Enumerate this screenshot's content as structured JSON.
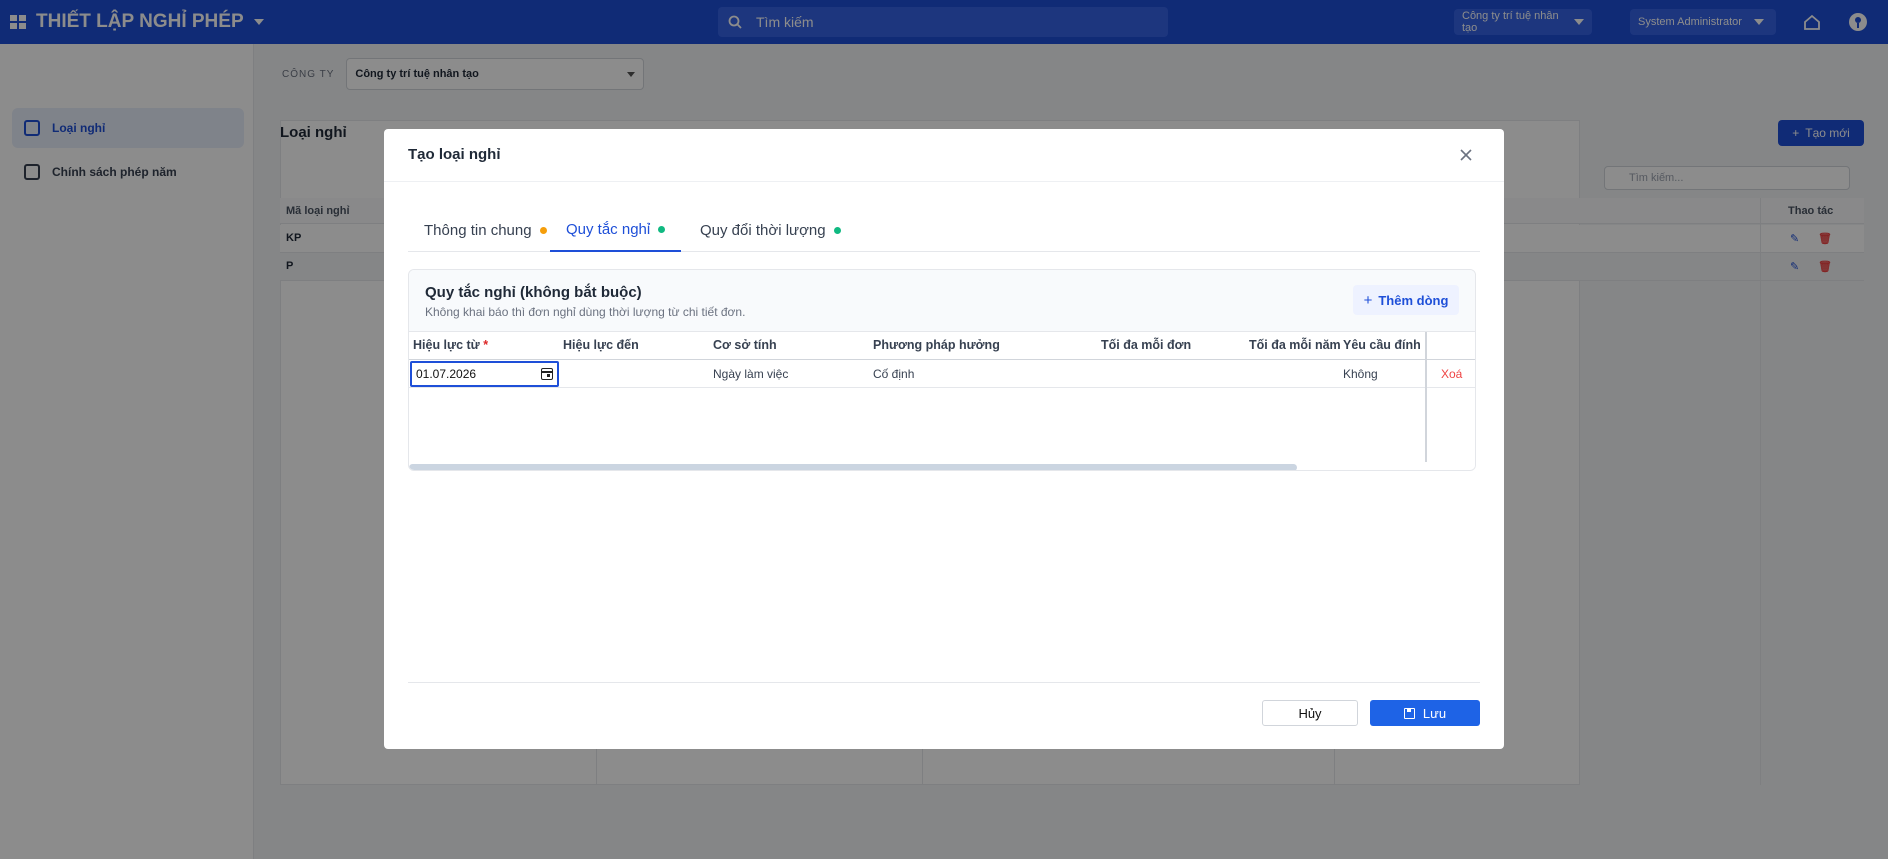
{
  "header": {
    "app_title": "THIẾT LẬP NGHỈ PHÉP",
    "search_placeholder": "Tìm kiếm",
    "company_pill": "Công ty trí tuệ nhân tạo",
    "user_pill": "System Administrator"
  },
  "sidebar": {
    "items": [
      {
        "label": "Loại nghỉ",
        "icon": "box-icon",
        "active": true
      },
      {
        "label": "Chính sách phép năm",
        "icon": "calendar-icon",
        "active": false
      }
    ]
  },
  "page": {
    "company_label": "CÔNG TY",
    "company_value": "Công ty trí tuệ nhân tạo",
    "title": "Loại nghỉ",
    "new_button": "Tạo mới",
    "search_placeholder": "Tìm kiếm...",
    "columns": [
      "Mã loại nghỉ",
      "Thao tác"
    ],
    "rows": [
      {
        "code": "KP"
      },
      {
        "code": "P"
      }
    ]
  },
  "modal": {
    "title": "Tạo loại nghỉ",
    "tabs": [
      {
        "label": "Thông tin chung",
        "dot_color": "#f59e0b",
        "active": false
      },
      {
        "label": "Quy tắc nghỉ",
        "dot_color": "#10b981",
        "active": true
      },
      {
        "label": "Quy đổi thời lượng",
        "dot_color": "#10b981",
        "active": false
      }
    ],
    "rules": {
      "title": "Quy tắc nghỉ (không bắt buộc)",
      "subtitle": "Không khai báo thì đơn nghỉ dùng thời lượng từ chi tiết đơn.",
      "add_button": "Thêm dòng",
      "columns": {
        "effective_from": "Hiệu lực từ",
        "required_mark": "*",
        "effective_to": "Hiệu lực đến",
        "basis": "Cơ sở tính",
        "method": "Phương pháp hưởng",
        "max_per_request": "Tối đa mỗi đơn",
        "max_per_year": "Tối đa mỗi năm",
        "attachment": "Yêu cầu đính k"
      },
      "rows": [
        {
          "effective_from": "01.07.2026",
          "effective_to": "",
          "basis": "Ngày làm việc",
          "method": "Cố định",
          "max_per_request": "",
          "max_per_year": "",
          "attachment": "Không",
          "delete": "Xoá"
        }
      ]
    },
    "footer": {
      "cancel": "Hủy",
      "save": "Lưu"
    }
  },
  "colors": {
    "primary": "#1e4fd8",
    "danger": "#ef4444",
    "warning_dot": "#f59e0b",
    "success_dot": "#10b981"
  }
}
